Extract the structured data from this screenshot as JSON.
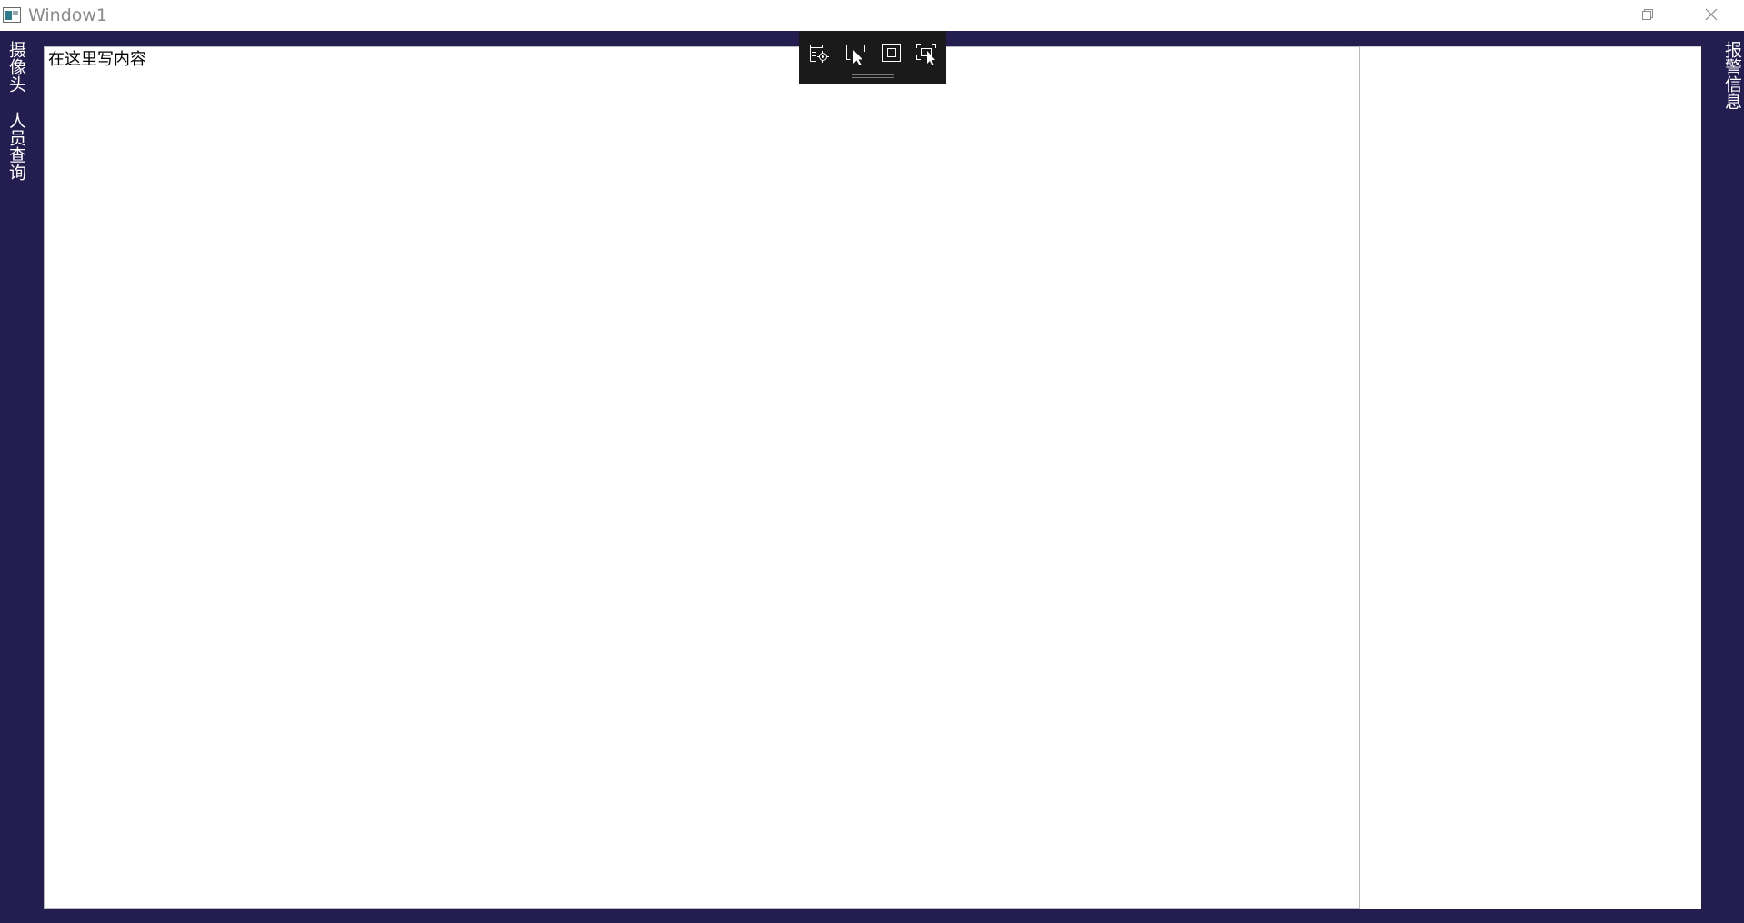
{
  "window": {
    "title": "Window1"
  },
  "left_nav": {
    "tabs": [
      {
        "label": "摄像头"
      },
      {
        "label": "人员查询"
      }
    ]
  },
  "main": {
    "placeholder_text": "在这里写内容"
  },
  "right_nav": {
    "tabs": [
      {
        "label": "报警信息"
      }
    ]
  },
  "icons": {
    "app": "app-window-icon",
    "minimize": "minimize-icon",
    "restore": "restore-icon",
    "close": "close-icon",
    "toolbar": [
      "live-visual-tree-icon",
      "select-element-icon",
      "display-layout-adorners-icon",
      "track-focused-element-icon"
    ]
  },
  "colors": {
    "background": "#241d50",
    "panel": "#ffffff",
    "toolbar": "#1a1a1a",
    "tab_text": "#ffffff"
  }
}
